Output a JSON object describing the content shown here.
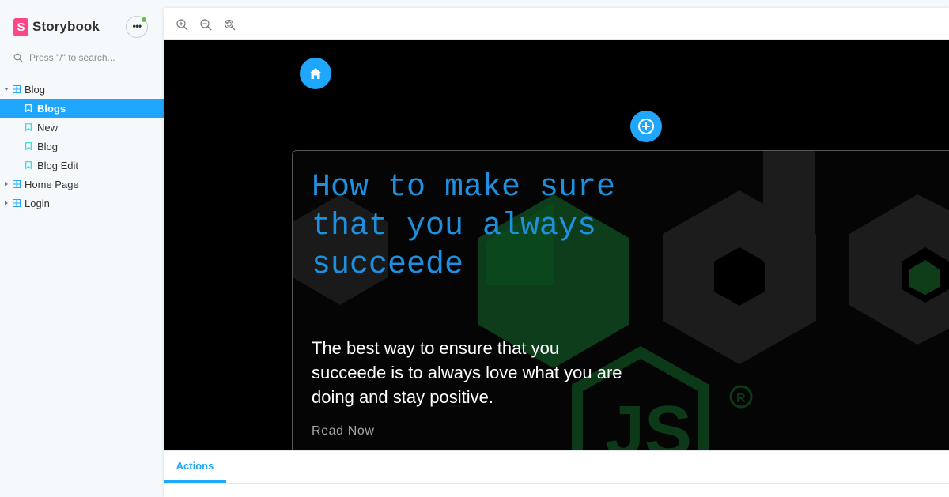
{
  "app": {
    "name": "Storybook",
    "logo_letter": "S"
  },
  "sidebar": {
    "search_placeholder": "Press \"/\" to search...",
    "tree": [
      {
        "label": "Blog",
        "kind": "group",
        "expanded": true
      },
      {
        "label": "Blogs",
        "kind": "story",
        "selected": true
      },
      {
        "label": "New",
        "kind": "story"
      },
      {
        "label": "Blog",
        "kind": "story"
      },
      {
        "label": "Blog Edit",
        "kind": "story"
      },
      {
        "label": "Home Page",
        "kind": "group",
        "expanded": false
      },
      {
        "label": "Login",
        "kind": "group",
        "expanded": false
      }
    ]
  },
  "toolbar": {
    "tools": [
      "zoom-in-icon",
      "zoom-out-icon",
      "reset-zoom-icon"
    ]
  },
  "preview": {
    "card": {
      "title": "How to make sure that you always succeede",
      "description": "The best way to ensure that you succeede is to always love what you are doing and stay positive.",
      "link": "Read Now"
    }
  },
  "addons": {
    "active_tab": "Actions"
  },
  "colors": {
    "accent": "#1ea7fd",
    "brand": "#ff4785",
    "title_blue": "#1e90df"
  }
}
